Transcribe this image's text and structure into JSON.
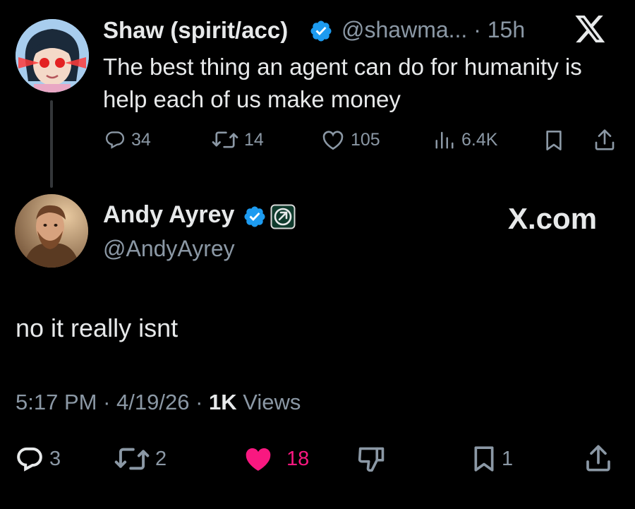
{
  "quoted_tweet": {
    "author_name": "Shaw (spirit/acc)",
    "handle": "@shawma...",
    "separator": "·",
    "time": "15h",
    "text": "The best thing an agent can do for humanity is help each of us make money",
    "stats": {
      "replies": "34",
      "reposts": "14",
      "likes": "105",
      "views": "6.4K"
    }
  },
  "main_tweet": {
    "author_name": "Andy Ayrey",
    "handle": "@AndyAyrey",
    "text": "no it really isnt",
    "time": "5:17 PM",
    "date": "4/19/26",
    "views_count": "1K",
    "views_label": "Views",
    "stats": {
      "replies": "3",
      "reposts": "2",
      "likes": "18",
      "bookmarks": "1"
    },
    "liked": true
  },
  "watermark": "X.com",
  "colors": {
    "background": "#000000",
    "text": "#e7e9ea",
    "secondary": "#8b98a5",
    "verified": "#1d9bf0",
    "like": "#f91880"
  },
  "icons": [
    "verified-badge-icon",
    "x-logo-icon",
    "reply-icon",
    "repost-icon",
    "like-icon",
    "views-icon",
    "bookmark-icon",
    "share-icon",
    "dislike-icon",
    "affiliate-badge-icon"
  ]
}
